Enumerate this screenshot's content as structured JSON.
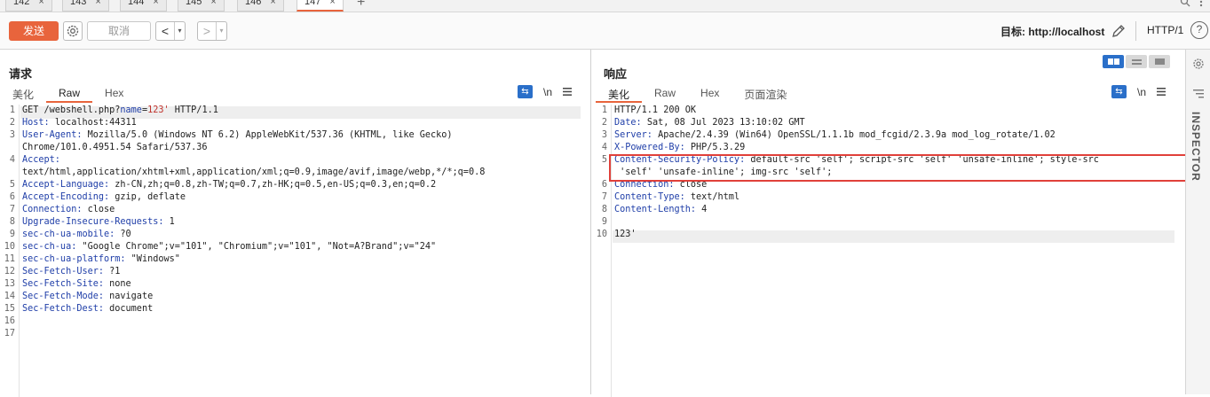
{
  "tabs": [
    {
      "label": "142",
      "close": "×"
    },
    {
      "label": "143",
      "close": "×"
    },
    {
      "label": "144",
      "close": "×"
    },
    {
      "label": "145",
      "close": "×"
    },
    {
      "label": "146",
      "close": "×"
    },
    {
      "label": "147",
      "close": "×"
    }
  ],
  "tab_add": "+",
  "toolbar": {
    "send_label": "发送",
    "cancel_label": "取消",
    "back_arrow": "<",
    "forward_arrow": ">",
    "caret": "▾",
    "target_label": "目标: http://localhost",
    "http_version": "HTTP/1",
    "help": "?"
  },
  "request": {
    "title": "请求",
    "subtabs": [
      "美化",
      "Raw",
      "Hex"
    ],
    "active_subtab": "Raw",
    "newline_toggle": "\\n",
    "lines": [
      {
        "n": "1",
        "parts": [
          [
            "GET /webshell.php?",
            "key"
          ],
          [
            "name",
            "kblue"
          ],
          [
            "=",
            "key"
          ],
          [
            "123'",
            "kred"
          ],
          [
            " HTTP/1.1",
            "key"
          ]
        ]
      },
      {
        "n": "2",
        "parts": [
          [
            "Host: ",
            "kblue"
          ],
          [
            "localhost:44311",
            "key"
          ]
        ]
      },
      {
        "n": "3",
        "parts": [
          [
            "User-Agent: ",
            "kblue"
          ],
          [
            "Mozilla/5.0 (Windows NT 6.2) AppleWebKit/537.36 (KHTML, like Gecko)",
            "key"
          ]
        ]
      },
      {
        "n": "",
        "parts": [
          [
            "Chrome/101.0.4951.54 Safari/537.36",
            "key"
          ]
        ]
      },
      {
        "n": "4",
        "parts": [
          [
            "Accept: ",
            "kblue"
          ]
        ]
      },
      {
        "n": "",
        "parts": [
          [
            "text/html,application/xhtml+xml,application/xml;q=0.9,image/avif,image/webp,*/*;q=0.8",
            "key"
          ]
        ]
      },
      {
        "n": "5",
        "parts": [
          [
            "Accept-Language: ",
            "kblue"
          ],
          [
            "zh-CN,zh;q=0.8,zh-TW;q=0.7,zh-HK;q=0.5,en-US;q=0.3,en;q=0.2",
            "key"
          ]
        ]
      },
      {
        "n": "6",
        "parts": [
          [
            "Accept-Encoding: ",
            "kblue"
          ],
          [
            "gzip, deflate",
            "key"
          ]
        ]
      },
      {
        "n": "7",
        "parts": [
          [
            "Connection: ",
            "kblue"
          ],
          [
            "close",
            "key"
          ]
        ]
      },
      {
        "n": "8",
        "parts": [
          [
            "Upgrade-Insecure-Requests: ",
            "kblue"
          ],
          [
            "1",
            "key"
          ]
        ]
      },
      {
        "n": "9",
        "parts": [
          [
            "sec-ch-ua-mobile: ",
            "kblue"
          ],
          [
            "?0",
            "key"
          ]
        ]
      },
      {
        "n": "10",
        "parts": [
          [
            "sec-ch-ua: ",
            "kblue"
          ],
          [
            "\"Google Chrome\";v=\"101\", \"Chromium\";v=\"101\", \"Not=A?Brand\";v=\"24\"",
            "key"
          ]
        ]
      },
      {
        "n": "11",
        "parts": [
          [
            "sec-ch-ua-platform: ",
            "kblue"
          ],
          [
            "\"Windows\"",
            "key"
          ]
        ]
      },
      {
        "n": "12",
        "parts": [
          [
            "Sec-Fetch-User: ",
            "kblue"
          ],
          [
            "?1",
            "key"
          ]
        ]
      },
      {
        "n": "13",
        "parts": [
          [
            "Sec-Fetch-Site: ",
            "kblue"
          ],
          [
            "none",
            "key"
          ]
        ]
      },
      {
        "n": "14",
        "parts": [
          [
            "Sec-Fetch-Mode: ",
            "kblue"
          ],
          [
            "navigate",
            "key"
          ]
        ]
      },
      {
        "n": "15",
        "parts": [
          [
            "Sec-Fetch-Dest: ",
            "kblue"
          ],
          [
            "document",
            "key"
          ]
        ]
      },
      {
        "n": "16",
        "parts": []
      },
      {
        "n": "17",
        "parts": []
      }
    ]
  },
  "response": {
    "title": "响应",
    "subtabs": [
      "美化",
      "Raw",
      "Hex",
      "页面渲染"
    ],
    "active_subtab": "美化",
    "newline_toggle": "\\n",
    "lines": [
      {
        "n": "1",
        "parts": [
          [
            "HTTP/1.1 200 OK",
            "key"
          ]
        ]
      },
      {
        "n": "2",
        "parts": [
          [
            "Date: ",
            "kblue"
          ],
          [
            "Sat, 08 Jul 2023 13:10:02 GMT",
            "key"
          ]
        ]
      },
      {
        "n": "3",
        "parts": [
          [
            "Server: ",
            "kblue"
          ],
          [
            "Apache/2.4.39 (Win64) OpenSSL/1.1.1b mod_fcgid/2.3.9a mod_log_rotate/1.02",
            "key"
          ]
        ]
      },
      {
        "n": "4",
        "parts": [
          [
            "X-Powered-By: ",
            "kblue"
          ],
          [
            "PHP/5.3.29",
            "key"
          ]
        ]
      },
      {
        "n": "5",
        "parts": [
          [
            "Content-Security-Policy: ",
            "kblue"
          ],
          [
            "default-src 'self'; script-src 'self' 'unsafe-inline'; style-src",
            "key"
          ]
        ]
      },
      {
        "n": "",
        "parts": [
          [
            " 'self' 'unsafe-inline'; img-src 'self';",
            "key"
          ]
        ]
      },
      {
        "n": "6",
        "parts": [
          [
            "Connection: ",
            "kblue"
          ],
          [
            "close",
            "key"
          ]
        ]
      },
      {
        "n": "7",
        "parts": [
          [
            "Content-Type: ",
            "kblue"
          ],
          [
            "text/html",
            "key"
          ]
        ]
      },
      {
        "n": "8",
        "parts": [
          [
            "Content-Length: ",
            "kblue"
          ],
          [
            "4",
            "key"
          ]
        ]
      },
      {
        "n": "9",
        "parts": []
      },
      {
        "n": "10",
        "parts": [
          [
            "123'",
            "key"
          ]
        ]
      }
    ]
  },
  "inspector": {
    "label": "INSPECTOR"
  },
  "colors": {
    "accent": "#e8643c",
    "header_name": "#1f3ea8",
    "param_value": "#c0322c",
    "highlight_box": "#e0403a",
    "icon_blue": "#2a6fc9"
  }
}
